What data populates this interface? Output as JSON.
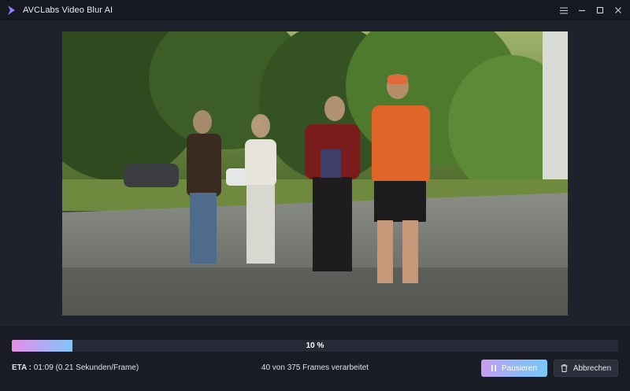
{
  "window": {
    "title": "AVCLabs Video Blur AI",
    "icons": [
      "logo-icon",
      "menu-icon",
      "minimize-icon",
      "maximize-icon",
      "close-icon"
    ]
  },
  "progress": {
    "percent": 10,
    "label": "10 %"
  },
  "status": {
    "eta_prefix": "ETA :",
    "eta_value": " 01:09 (0.21 Sekunden/Frame)",
    "frames_text": "40 von 375 Frames verarbeitet"
  },
  "buttons": {
    "pause_label": "Pausieren",
    "cancel_label": "Abbrechen"
  },
  "colors": {
    "accent_gradient_start": "#e58ee8",
    "accent_gradient_end": "#7ec6f7",
    "background": "#1e222d"
  }
}
